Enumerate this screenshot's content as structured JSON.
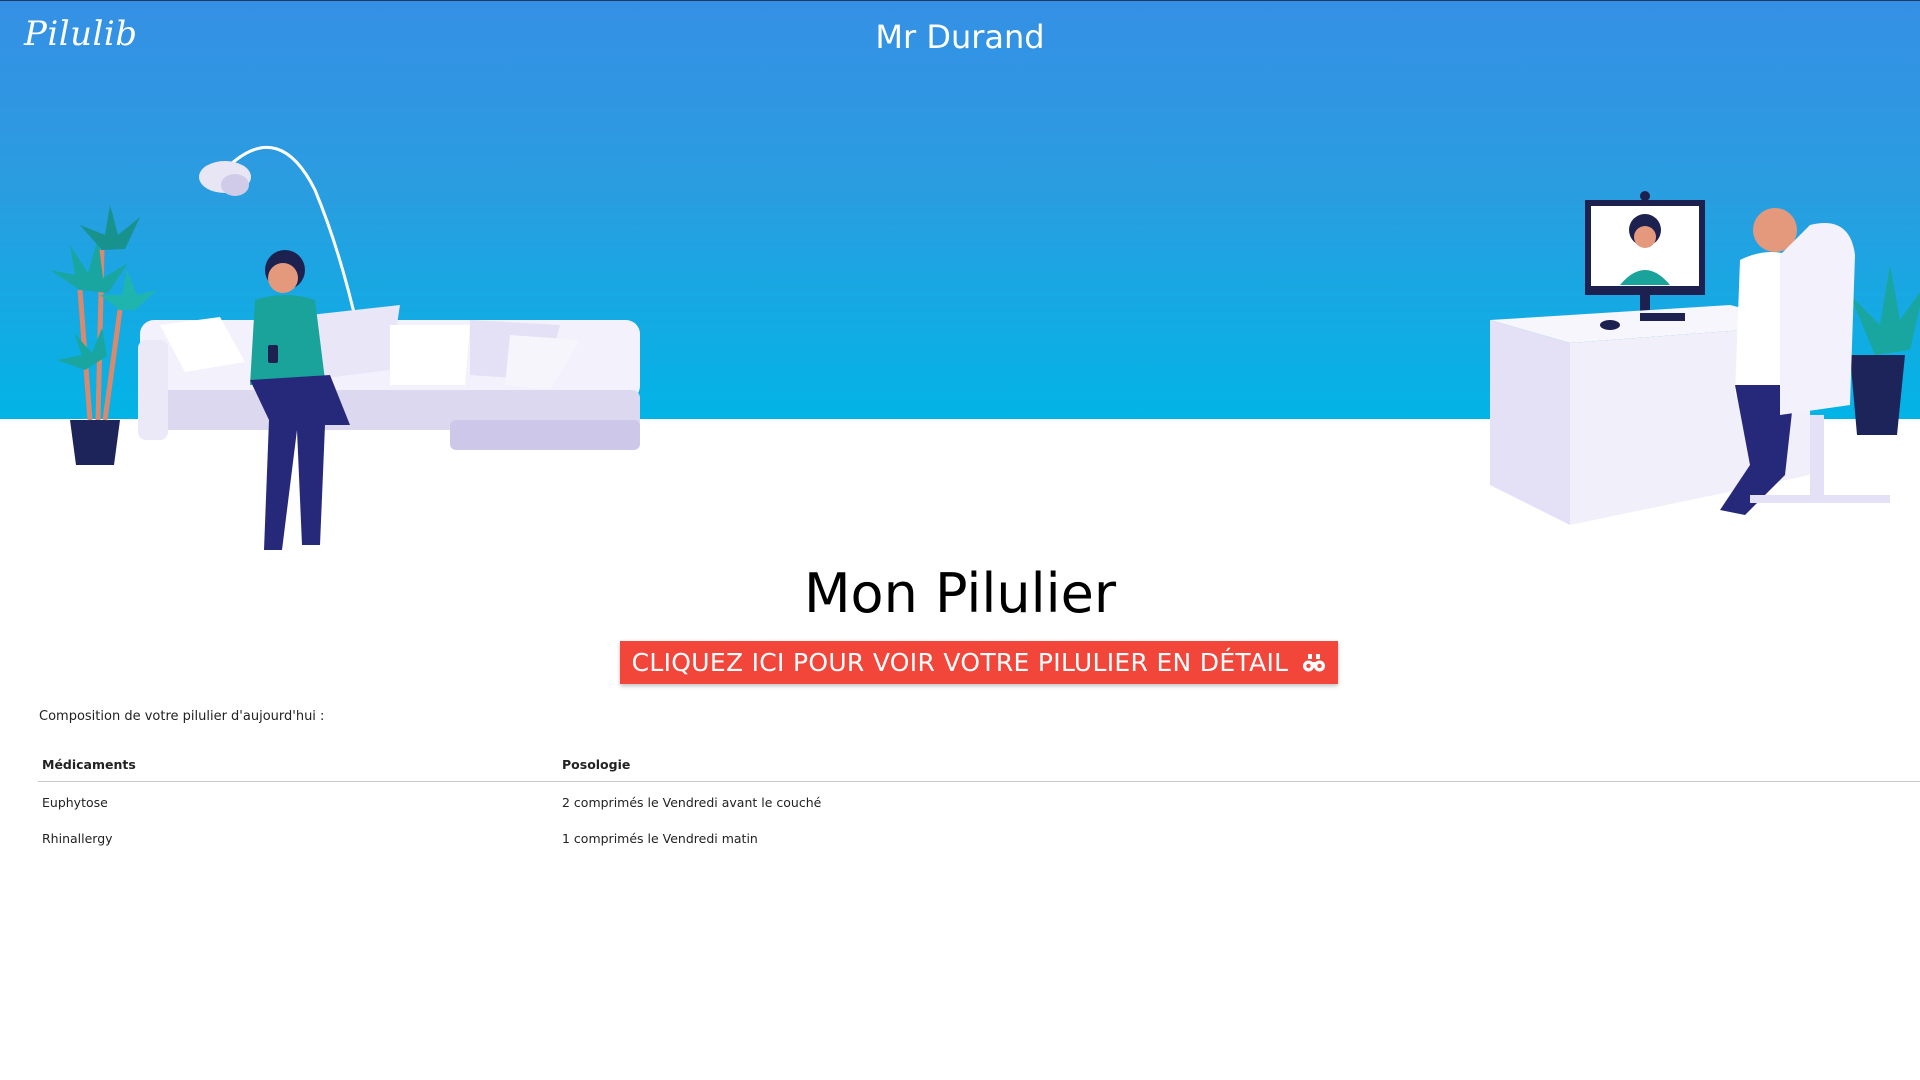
{
  "header": {
    "logo": "Pilulib",
    "user_name": "Mr Durand",
    "colors": {
      "gradient_top": "#3590e5",
      "gradient_bottom": "#02b4e6"
    }
  },
  "illustrations": {
    "left": "woman-on-sofa-with-phone",
    "right": "doctor-video-consultation"
  },
  "main": {
    "title": "Mon Pilulier",
    "detail_button": {
      "label": "CLIQUEZ ICI POUR VOIR VOTRE PILULIER EN DÉTAIL",
      "icon": "binoculars-icon",
      "color": "#f3463a"
    },
    "intro_text": "Composition de votre pilulier d'aujourd'hui :",
    "table": {
      "columns": [
        "Médicaments",
        "Posologie"
      ],
      "rows": [
        {
          "medicament": "Euphytose",
          "posologie": "2 comprimés le Vendredi avant le couché"
        },
        {
          "medicament": "Rhinallergy",
          "posologie": "1 comprimés le Vendredi matin"
        }
      ]
    }
  }
}
